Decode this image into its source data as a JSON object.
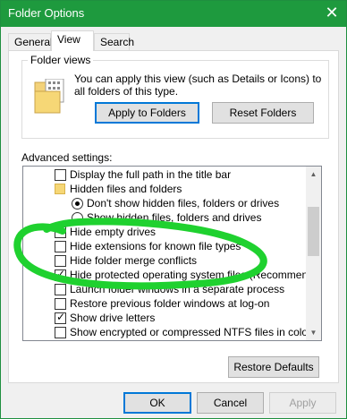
{
  "window": {
    "title": "Folder Options",
    "close_glyph": "✕"
  },
  "tabs": [
    {
      "label": "General",
      "active": false
    },
    {
      "label": "View",
      "active": true
    },
    {
      "label": "Search",
      "active": false
    }
  ],
  "folder_views": {
    "legend": "Folder views",
    "description": "You can apply this view (such as Details or Icons) to all folders of this type.",
    "apply_button": "Apply to Folders",
    "reset_button": "Reset Folders"
  },
  "advanced": {
    "label": "Advanced settings:",
    "items": [
      {
        "type": "checkbox",
        "checked": false,
        "indent": 1,
        "label": "Display the full path in the title bar"
      },
      {
        "type": "folder",
        "indent": 1,
        "label": "Hidden files and folders"
      },
      {
        "type": "radio",
        "checked": true,
        "indent": 2,
        "label": "Don't show hidden files, folders or drives"
      },
      {
        "type": "radio",
        "checked": false,
        "indent": 2,
        "label": "Show hidden files, folders and drives"
      },
      {
        "type": "checkbox",
        "checked": false,
        "indent": 1,
        "label": "Hide empty drives"
      },
      {
        "type": "checkbox",
        "checked": false,
        "indent": 1,
        "label": "Hide extensions for known file types"
      },
      {
        "type": "checkbox",
        "checked": false,
        "indent": 1,
        "label": "Hide folder merge conflicts"
      },
      {
        "type": "checkbox",
        "checked": true,
        "indent": 1,
        "label": "Hide protected operating system files (Recommended)"
      },
      {
        "type": "checkbox",
        "checked": false,
        "indent": 1,
        "label": "Launch folder windows in a separate process"
      },
      {
        "type": "checkbox",
        "checked": false,
        "indent": 1,
        "label": "Restore previous folder windows at log-on"
      },
      {
        "type": "checkbox",
        "checked": true,
        "indent": 1,
        "label": "Show drive letters"
      },
      {
        "type": "checkbox",
        "checked": false,
        "indent": 1,
        "label": "Show encrypted or compressed NTFS files in colour"
      }
    ],
    "restore_defaults_button": "Restore Defaults"
  },
  "footer": {
    "ok_button": "OK",
    "cancel_button": "Cancel",
    "apply_button": "Apply"
  },
  "colors": {
    "titlebar": "#1e9a3e",
    "annotation": "#1fd12f"
  }
}
